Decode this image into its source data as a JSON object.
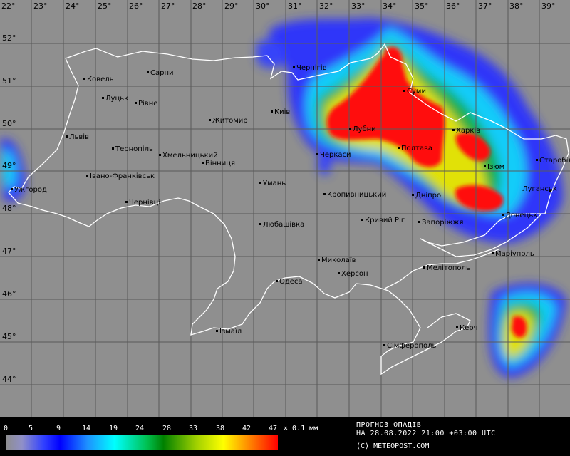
{
  "map": {
    "longitude_labels": [
      "22°",
      "23°",
      "24°",
      "25°",
      "26°",
      "27°",
      "28°",
      "29°",
      "30°",
      "31°",
      "32°",
      "33°",
      "34°",
      "35°",
      "36°",
      "37°",
      "38°",
      "39°"
    ],
    "latitude_labels": [
      "52°",
      "51°",
      "50°",
      "49°",
      "48°",
      "47°",
      "46°",
      "45°",
      "44°"
    ],
    "cities": [
      {
        "name": "Ковель"
      },
      {
        "name": "Сарни"
      },
      {
        "name": "Чернігів"
      },
      {
        "name": "Луцьк"
      },
      {
        "name": "Рівне"
      },
      {
        "name": "Суми"
      },
      {
        "name": "Київ"
      },
      {
        "name": "Житомир"
      },
      {
        "name": "Лубни"
      },
      {
        "name": "Харків"
      },
      {
        "name": "Львів"
      },
      {
        "name": "Тернопіль"
      },
      {
        "name": "Полтава"
      },
      {
        "name": "Черкаси"
      },
      {
        "name": "Хмельницький"
      },
      {
        "name": "Вінниця"
      },
      {
        "name": "Ізюм"
      },
      {
        "name": "Старобільськ"
      },
      {
        "name": "Івано-Франківськ"
      },
      {
        "name": "Умань"
      },
      {
        "name": "Ужгород"
      },
      {
        "name": "Кропивницький"
      },
      {
        "name": "Дніпро"
      },
      {
        "name": "Луганськ"
      },
      {
        "name": "Чернівці"
      },
      {
        "name": "Донецьк"
      },
      {
        "name": "Кривий Ріг"
      },
      {
        "name": "Запоріжжя"
      },
      {
        "name": "Любашівка"
      },
      {
        "name": "Маріуполь"
      },
      {
        "name": "Миколаїв"
      },
      {
        "name": "Мелітополь"
      },
      {
        "name": "Херсон"
      },
      {
        "name": "Одеса"
      },
      {
        "name": "Керч"
      },
      {
        "name": "Ізмаїл"
      },
      {
        "name": "Сімферополь"
      }
    ]
  },
  "legend": {
    "ticks": [
      "0",
      "5",
      "9",
      "14",
      "19",
      "24",
      "28",
      "33",
      "38",
      "42",
      "47"
    ],
    "unit": "× 0.1 мм",
    "title": "ПРОГНОЗ ОПАДІВ",
    "date": "НА 28.08.2022 21:00 +03:00 UTC",
    "copyright": "(C) METEOPOST.COM",
    "colors": [
      "#8e8e8e",
      "#3040ff",
      "#00ffff",
      "#008000",
      "#ffff00",
      "#ff0000"
    ]
  }
}
